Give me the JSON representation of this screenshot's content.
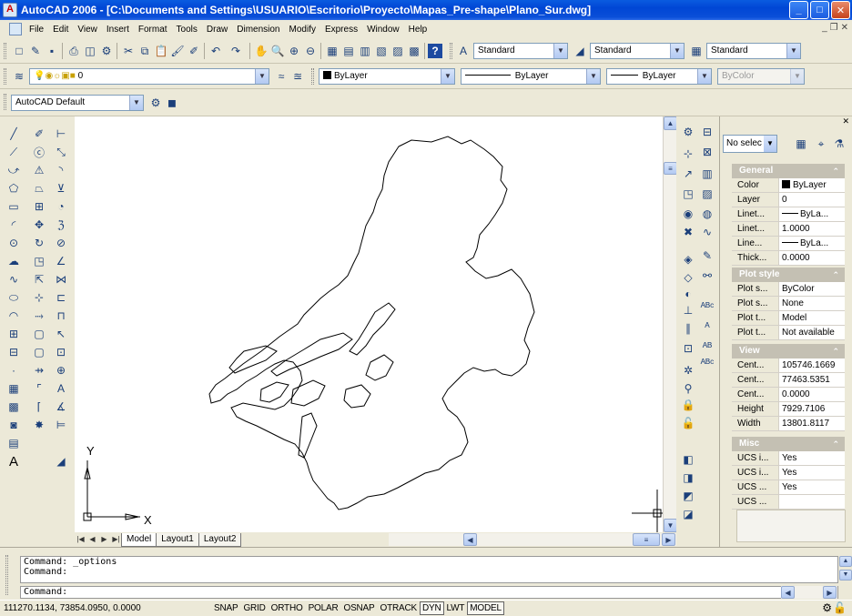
{
  "window": {
    "title": "AutoCAD 2006 - [C:\\Documents and Settings\\USUARIO\\Escritorio\\Proyecto\\Mapas_Pre-shape\\Plano_Sur.dwg]",
    "min": "_",
    "max": "□",
    "close": "✕"
  },
  "menu": [
    "File",
    "Edit",
    "View",
    "Insert",
    "Format",
    "Tools",
    "Draw",
    "Dimension",
    "Modify",
    "Express",
    "Window",
    "Help"
  ],
  "toolbar": {
    "text_style": "Standard",
    "dim_style": "Standard",
    "table_style": "Standard",
    "layer": "0",
    "color": "ByLayer",
    "linetype": "ByLayer",
    "lineweight": "ByLayer",
    "plot_style": "ByColor",
    "workspace": "AutoCAD Default"
  },
  "layout_tabs": [
    "Model",
    "Layout1",
    "Layout2"
  ],
  "ucs": {
    "x_label": "X",
    "y_label": "Y"
  },
  "properties": {
    "selection": "No selec",
    "groups": [
      {
        "title": "General",
        "rows": [
          {
            "key": "Color",
            "value": "ByLayer",
            "kind": "swatch"
          },
          {
            "key": "Layer",
            "value": "0"
          },
          {
            "key": "Linet...",
            "value": "ByLa...",
            "kind": "line"
          },
          {
            "key": "Linet...",
            "value": "1.0000"
          },
          {
            "key": "Line...",
            "value": "ByLa...",
            "kind": "line"
          },
          {
            "key": "Thick...",
            "value": "0.0000"
          }
        ]
      },
      {
        "title": "Plot style",
        "rows": [
          {
            "key": "Plot s...",
            "value": "ByColor"
          },
          {
            "key": "Plot s...",
            "value": "None"
          },
          {
            "key": "Plot t...",
            "value": "Model"
          },
          {
            "key": "Plot t...",
            "value": "Not available"
          }
        ]
      },
      {
        "title": "View",
        "rows": [
          {
            "key": "Cent...",
            "value": "105746.1669"
          },
          {
            "key": "Cent...",
            "value": "77463.5351"
          },
          {
            "key": "Cent...",
            "value": "0.0000"
          },
          {
            "key": "Height",
            "value": "7929.7106"
          },
          {
            "key": "Width",
            "value": "13801.8117"
          }
        ]
      },
      {
        "title": "Misc",
        "rows": [
          {
            "key": "UCS i...",
            "value": "Yes"
          },
          {
            "key": "UCS i...",
            "value": "Yes"
          },
          {
            "key": "UCS ...",
            "value": "Yes"
          },
          {
            "key": "UCS ...",
            "value": ""
          }
        ]
      }
    ]
  },
  "command": {
    "history_1": "Command: _options",
    "history_2": "Command:",
    "prompt": "Command:"
  },
  "status": {
    "coords": "111270.1134, 73854.0950, 0.0000",
    "toggles": [
      {
        "label": "SNAP",
        "on": false
      },
      {
        "label": "GRID",
        "on": false
      },
      {
        "label": "ORTHO",
        "on": false
      },
      {
        "label": "POLAR",
        "on": false
      },
      {
        "label": "OSNAP",
        "on": false
      },
      {
        "label": "OTRACK",
        "on": false
      },
      {
        "label": "DYN",
        "on": true
      },
      {
        "label": "LWT",
        "on": false
      },
      {
        "label": "MODEL",
        "on": true
      }
    ]
  }
}
